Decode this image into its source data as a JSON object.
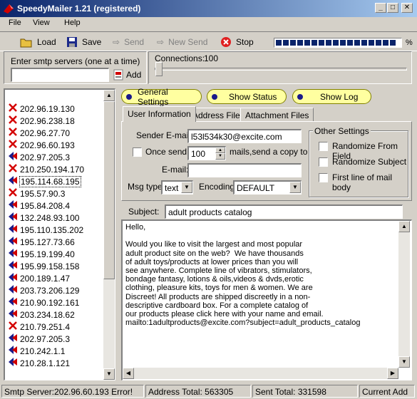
{
  "window": {
    "title": "SpeedyMailer 1.21 (registered)"
  },
  "menu": [
    "File",
    "View",
    "Help"
  ],
  "toolbar": {
    "load": "Load",
    "save": "Save",
    "send": "Send",
    "new_send": "New Send",
    "stop": "Stop",
    "progress_percent_label": "%"
  },
  "smtp": {
    "label": "Enter smtp servers (one at a time)",
    "value": "",
    "add": "Add"
  },
  "connections": {
    "label": "Connections:",
    "value": "100"
  },
  "servers": [
    {
      "ip": "202.96.19.130",
      "status": "fail"
    },
    {
      "ip": "202.96.238.18",
      "status": "fail"
    },
    {
      "ip": "202.96.27.70",
      "status": "fail"
    },
    {
      "ip": "202.96.60.193",
      "status": "fail"
    },
    {
      "ip": "202.97.205.3",
      "status": "ok"
    },
    {
      "ip": "210.250.194.170",
      "status": "fail"
    },
    {
      "ip": "195.114.68.195",
      "status": "ok",
      "selected": true
    },
    {
      "ip": "195.57.90.3",
      "status": "fail"
    },
    {
      "ip": "195.84.208.4",
      "status": "ok"
    },
    {
      "ip": "132.248.93.100",
      "status": "ok"
    },
    {
      "ip": "195.110.135.202",
      "status": "ok"
    },
    {
      "ip": "195.127.73.66",
      "status": "ok"
    },
    {
      "ip": "195.19.199.40",
      "status": "ok"
    },
    {
      "ip": "195.99.158.158",
      "status": "ok"
    },
    {
      "ip": "200.189.1.47",
      "status": "ok"
    },
    {
      "ip": "203.73.206.129",
      "status": "ok"
    },
    {
      "ip": "210.90.192.161",
      "status": "ok"
    },
    {
      "ip": "203.234.18.62",
      "status": "ok"
    },
    {
      "ip": "210.79.251.4",
      "status": "fail"
    },
    {
      "ip": "202.97.205.3",
      "status": "ok"
    },
    {
      "ip": "210.242.1.1",
      "status": "ok"
    },
    {
      "ip": "210.28.1.121",
      "status": "ok"
    }
  ],
  "pills": {
    "general": "General Settings",
    "status": "Show Status",
    "log": "Show Log"
  },
  "tabs": {
    "user_info": "User Information",
    "address": "Address Files",
    "attachment": "Attachment Files"
  },
  "form": {
    "sender_label": "Sender E-mail:",
    "sender_value": "l53l534k30@excite.com",
    "once_send_label": "Once send:",
    "once_send_value": "100",
    "once_send_suffix": "mails,send a copy to",
    "email_label": "E-mail:",
    "email_value": "",
    "msg_type_label": "Msg type:",
    "msg_type_value": "text",
    "encoding_label": "Encoding:",
    "encoding_value": "DEFAULT"
  },
  "other_settings": {
    "title": "Other Settings",
    "randomize_from": "Randomize From Field",
    "randomize_subject": "Randomize Subject",
    "first_line": "First line of mail body"
  },
  "subject": {
    "label": "Subject:",
    "value": "adult products catalog"
  },
  "body_lines": [
    "Hello,",
    "",
    "Would you like to visit the largest and most popular",
    "adult product site on the web?  We have thousands",
    "of adult toys/products at lower prices than you will",
    "see anywhere. Complete line of vibrators, stimulators,",
    "bondage fantasy, lotions & oils,videos & dvds,erotic",
    "clothing, pleasure kits, toys for men & women. We are",
    "Discreet! All products are shipped discreetly in a non-",
    "descriptive cardboard box. For a complete catalog of",
    "our products please click here with your name and email.",
    "mailto:1adultproducts@excite.com?subject=adult_products_catalog"
  ],
  "status": {
    "smtp": "Smtp Server:202.96.60.193 Error!",
    "address_total": "Address Total: 563305",
    "sent_total": "Sent Total: 331598",
    "current_add": "Current Add"
  },
  "colors": {
    "titlebar": "#0a246a",
    "pill": "#ffffa0",
    "fail": "#d40000",
    "ok": "#1a1a8a"
  }
}
